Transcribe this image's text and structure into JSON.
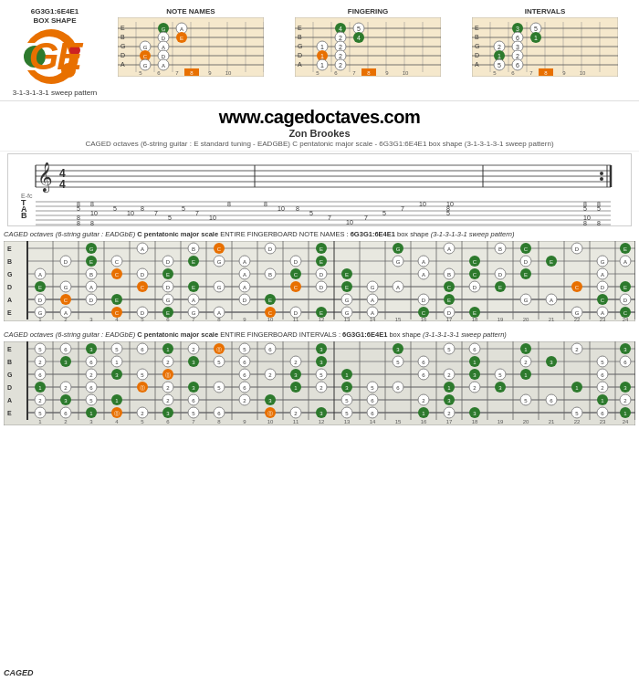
{
  "header": {
    "title": "6G3G1:6E4E1",
    "subtitle": "BOX SHAPE",
    "diagrams": [
      {
        "label": "NOTE NAMES"
      },
      {
        "label": "FINGERING"
      },
      {
        "label": "INTERVALS"
      }
    ],
    "logo_letters": "GE",
    "logo_subtitle": "3-1-3-1-3-1 sweep pattern"
  },
  "middle": {
    "url": "www.cagedoctaves.com",
    "author": "Zon Brookes",
    "description": "CAGED octaves (6-string guitar : E standard tuning - EADGBE) C pentatonic major scale - 6G3G1:6E4E1 box shape (3-1-3-1-3-1 sweep pattern)"
  },
  "notation": {
    "time_sig": "4/4"
  },
  "fingerboard_notes": {
    "caption_prefix": "CAGED octaves (6-string guitar : EADGbE)",
    "caption_scale": "C pentatonic major scale",
    "caption_type": "ENTIRE FINGERBOARD NOTE NAMES :",
    "caption_shape": "6G3G1:6E4E1",
    "caption_pattern": "box shape",
    "caption_sweep": "(3-1-3-1-3-1 sweep pattern)",
    "strings": [
      "E",
      "B",
      "G",
      "D",
      "A",
      "E"
    ],
    "fret_numbers": [
      1,
      2,
      3,
      4,
      5,
      6,
      7,
      8,
      9,
      10,
      11,
      12,
      13,
      14,
      15,
      16,
      17,
      18,
      19,
      20,
      21,
      22,
      23,
      24
    ],
    "notes": {
      "C": "#e87000",
      "D": "#fff",
      "E": "#fff",
      "G": "#2d7a2d",
      "A": "#fff"
    }
  },
  "fingerboard_intervals": {
    "caption_type": "ENTIRE FINGERBOARD INTERVALS :",
    "caption_shape": "6G3G1:6E4E1",
    "caption_pattern": "box shape",
    "caption_sweep": "(3-1-3-1-3-1 sweep pattern)",
    "intervals": {
      "1": "#2d7a2d",
      "2": "#fff",
      "3": "#2d7a2d",
      "5": "#e87000",
      "6": "#fff"
    }
  },
  "caged_label": "CAGED"
}
